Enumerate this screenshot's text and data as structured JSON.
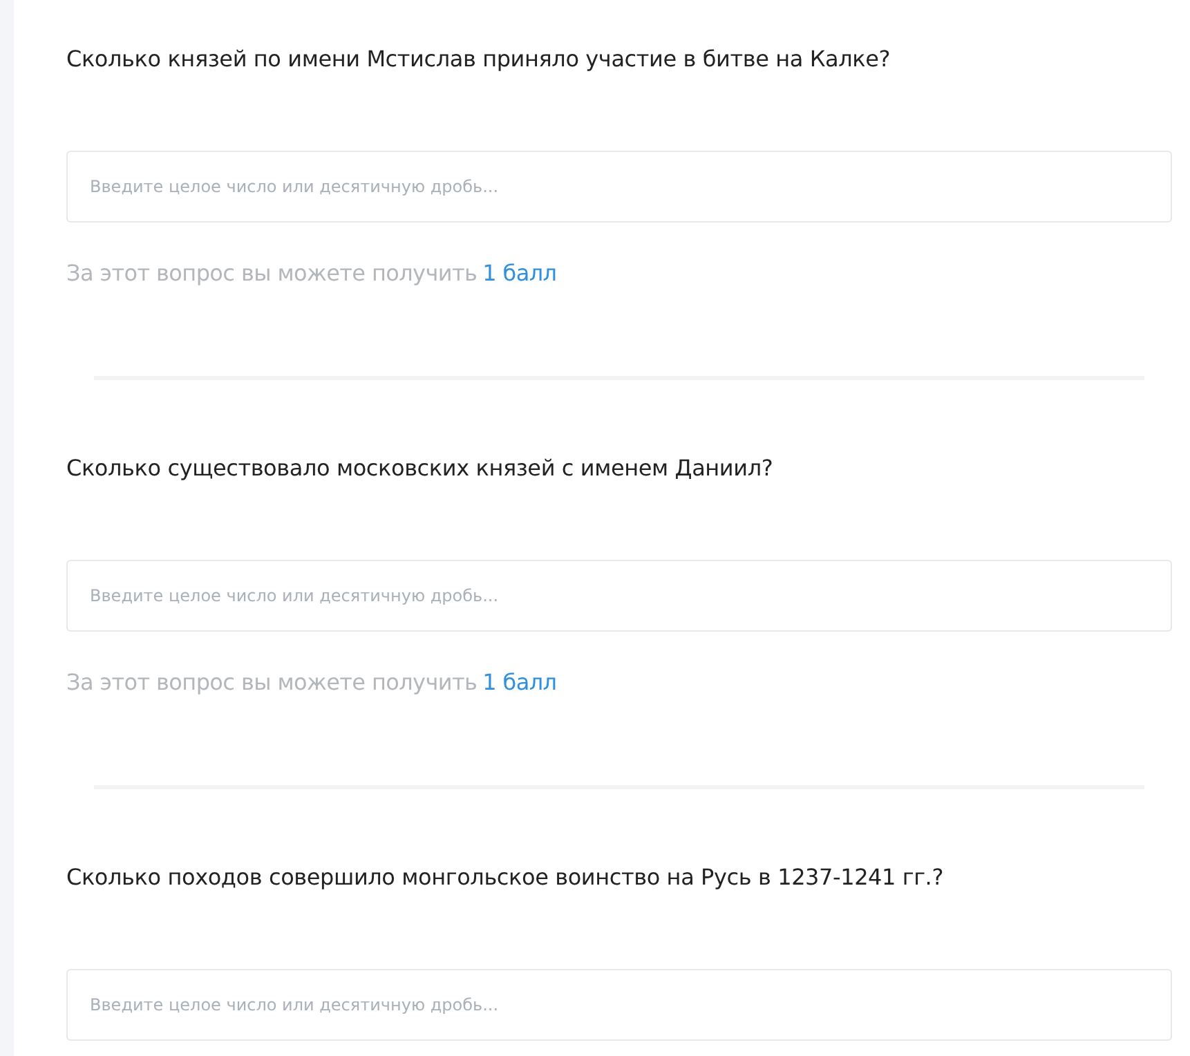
{
  "questions": [
    {
      "text": "Сколько князей по имени Мстислав приняло участие в битве на Калке?",
      "answer": {
        "placeholder": "Введите целое число или десятичную дробь..."
      },
      "points": {
        "prefix": "За этот вопрос вы можете получить",
        "value": "1 балл"
      }
    },
    {
      "text": "Сколько существовало московских князей с именем Даниил?",
      "answer": {
        "placeholder": "Введите целое число или десятичную дробь..."
      },
      "points": {
        "prefix": "За этот вопрос вы можете получить",
        "value": "1 балл"
      }
    },
    {
      "text": "Сколько походов совершило монгольское воинство на Русь в 1237-1241 гг.?",
      "answer": {
        "placeholder": "Введите целое число или десятичную дробь..."
      }
    }
  ]
}
